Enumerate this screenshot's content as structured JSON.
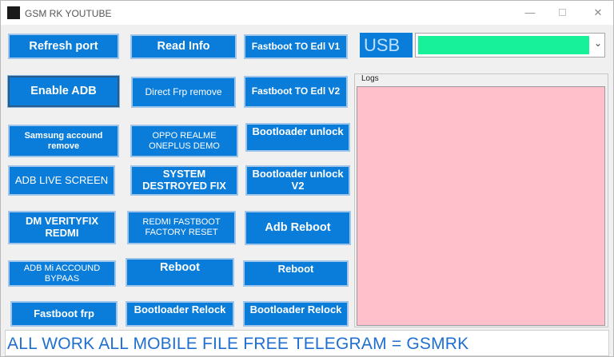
{
  "window": {
    "title": "GSM RK YOUTUBE",
    "controls": {
      "minimize": "—",
      "close": "✕"
    }
  },
  "buttons": {
    "refresh_port": "Refresh port",
    "read_info": "Read Info",
    "fastboot_edl_v1": "Fastboot TO Edl V1",
    "enable_adb": "Enable ADB",
    "direct_frp_remove": "Direct Frp remove",
    "fastboot_edl_v2": "Fastboot TO Edl V2",
    "samsung_account_remove": "Samsung accound remove",
    "oppo_realme_demo": "OPPO REALME ONEPLUS DEMO",
    "bootloader_unlock": "Bootloader unlock",
    "adb_live_screen": "ADB LIVE SCREEN",
    "system_destroyed_fix": "SYSTEM DESTROYED FIX",
    "bootloader_unlock_v2": "Bootloader unlock V2",
    "dm_verity_fix": "DM VERITYFIX REDMI",
    "redmi_fastboot_reset": "REDMI FASTBOOT FACTORY RESET",
    "adb_reboot": "Adb Reboot",
    "adb_mi_account_bypass": "ADB Mi ACCOUND BYPAAS",
    "reboot_1": "Reboot",
    "reboot_2": "Reboot",
    "fastboot_frp": "Fastboot frp",
    "bootloader_relock_1": "Bootloader Relock",
    "bootloader_relock_2": "Bootloader Relock"
  },
  "usb": {
    "label": "USB",
    "selected_value": ""
  },
  "logs": {
    "label": "Logs",
    "content": ""
  },
  "footer": {
    "text": "ALL WORK ALL MOBILE FILE FREE  TELEGRAM = GSMRK"
  },
  "colors": {
    "button_blue": "#0a7cda",
    "usb_fill": "#17f19a",
    "logs_bg": "#ffc0cb",
    "footer_text": "#1f6fd0"
  }
}
